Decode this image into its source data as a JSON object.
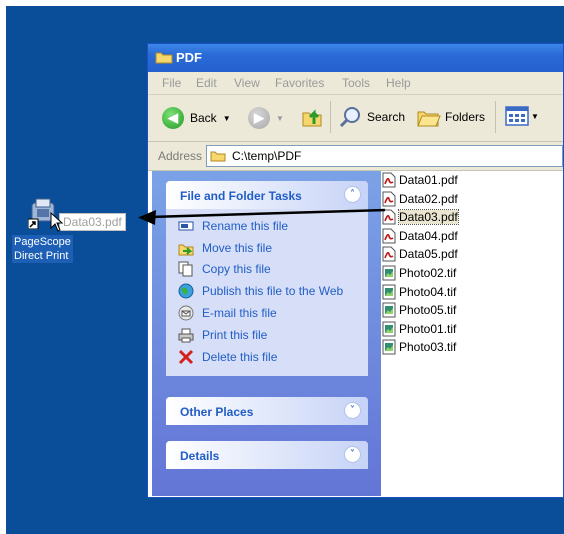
{
  "window": {
    "title": "PDF"
  },
  "menu": [
    "File",
    "Edit",
    "View",
    "Favorites",
    "Tools",
    "Help"
  ],
  "toolbar": {
    "back_label": "Back",
    "search_label": "Search",
    "folders_label": "Folders"
  },
  "address": {
    "label": "Address",
    "path": "C:\\temp\\PDF"
  },
  "tasks_panel": {
    "title": "File and Folder Tasks",
    "items": [
      {
        "label": "Rename this file",
        "icon": "rename-icon"
      },
      {
        "label": "Move this file",
        "icon": "move-icon"
      },
      {
        "label": "Copy this file",
        "icon": "copy-icon"
      },
      {
        "label": "Publish this file to the Web",
        "icon": "globe-icon"
      },
      {
        "label": "E-mail this file",
        "icon": "email-icon"
      },
      {
        "label": "Print this file",
        "icon": "printer-icon"
      },
      {
        "label": "Delete this file",
        "icon": "delete-icon"
      }
    ]
  },
  "other_places": {
    "title": "Other Places"
  },
  "details": {
    "title": "Details"
  },
  "files": [
    {
      "name": "Data01.pdf",
      "type": "pdf",
      "selected": false
    },
    {
      "name": "Data02.pdf",
      "type": "pdf",
      "selected": false
    },
    {
      "name": "Data03.pdf",
      "type": "pdf",
      "selected": true
    },
    {
      "name": "Data04.pdf",
      "type": "pdf",
      "selected": false
    },
    {
      "name": "Data05.pdf",
      "type": "pdf",
      "selected": false
    },
    {
      "name": "Photo02.tif",
      "type": "tif",
      "selected": false
    },
    {
      "name": "Photo04.tif",
      "type": "tif",
      "selected": false
    },
    {
      "name": "Photo05.tif",
      "type": "tif",
      "selected": false
    },
    {
      "name": "Photo01.tif",
      "type": "tif",
      "selected": false
    },
    {
      "name": "Photo03.tif",
      "type": "tif",
      "selected": false
    }
  ],
  "desktop": {
    "icon_label_line1": "PageScope",
    "icon_label_line2": "Direct Print",
    "drag_label": "Data03.pdf"
  },
  "colors": {
    "desktop": "#0a4e9a",
    "titlebar": "#2a6ad6",
    "task_link": "#215dc6"
  }
}
